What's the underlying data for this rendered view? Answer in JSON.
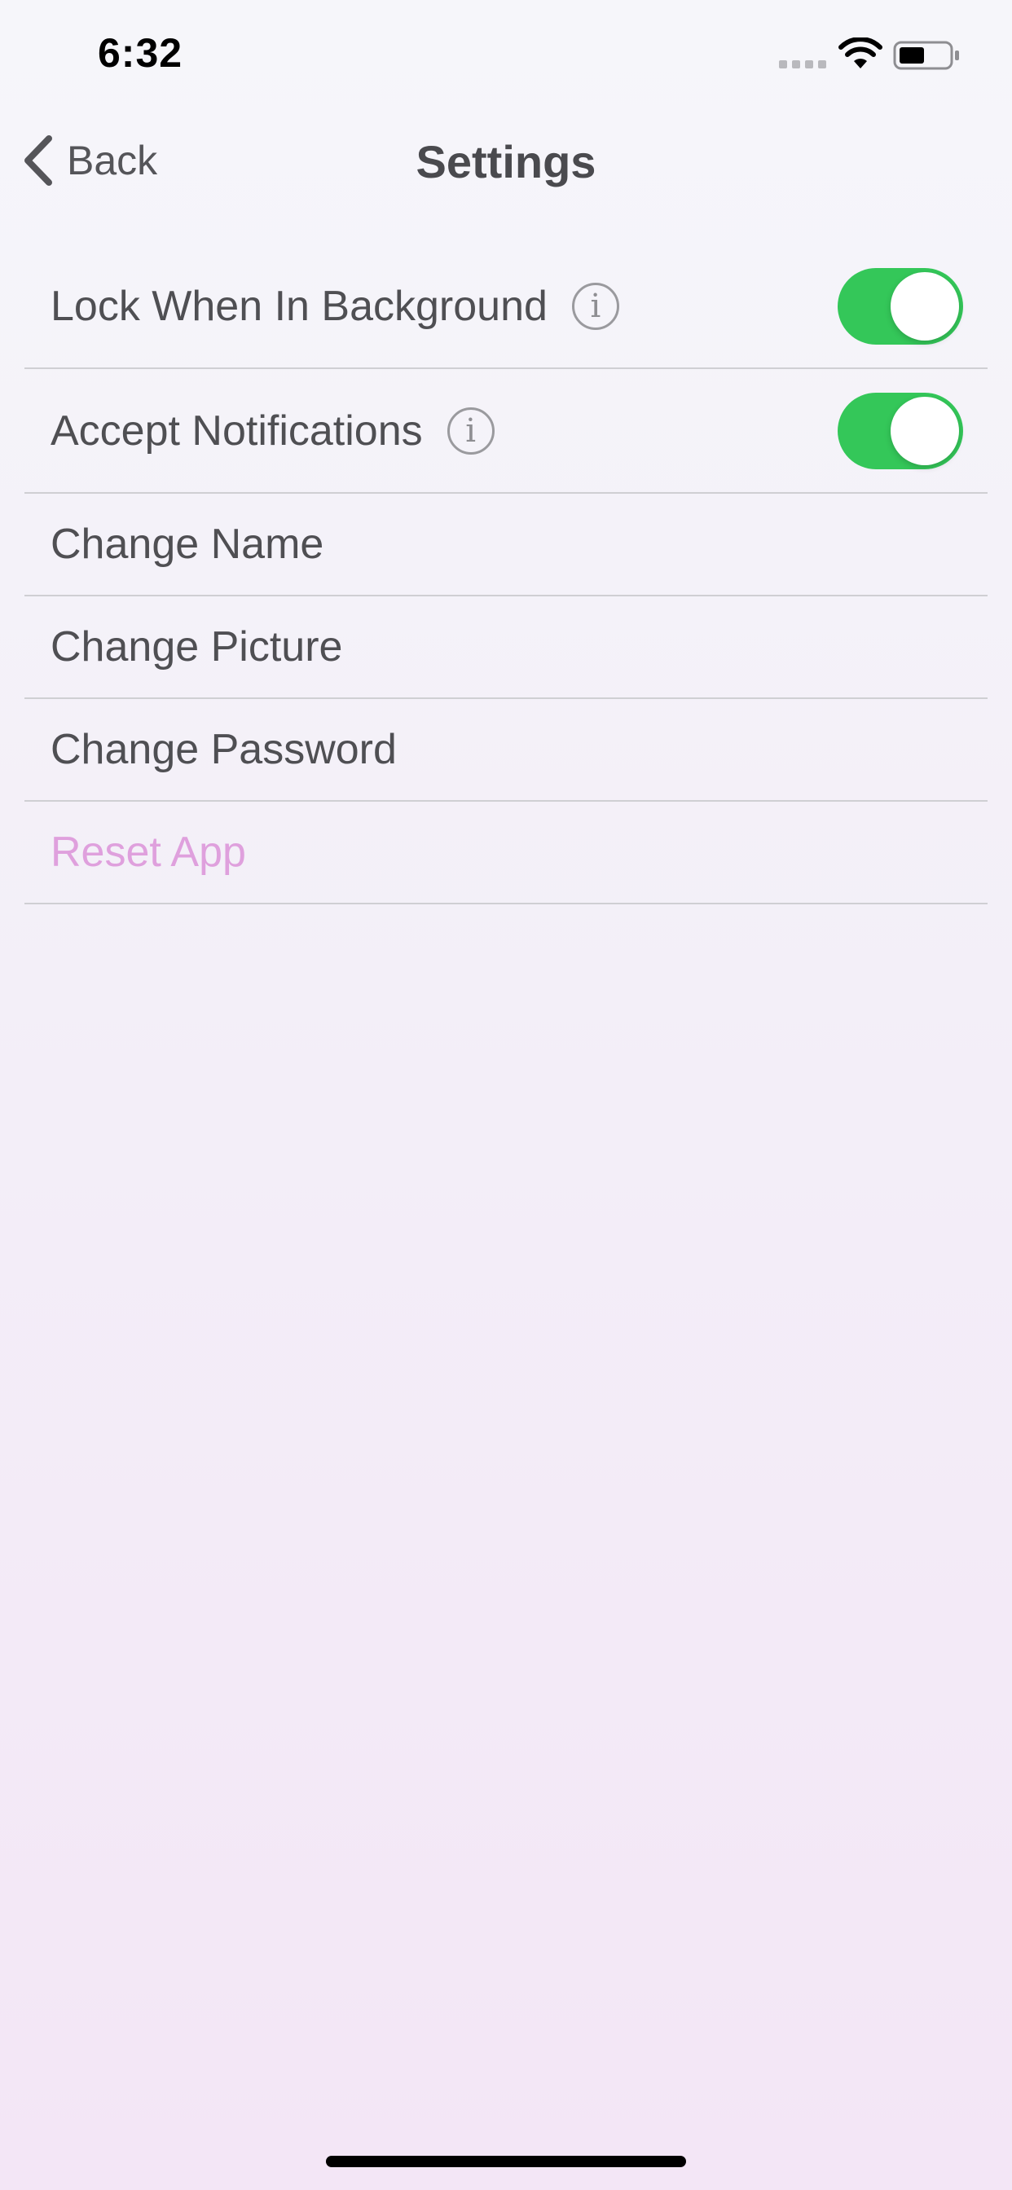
{
  "status_bar": {
    "time": "6:32",
    "icons": [
      "signal-dots-icon",
      "wifi-icon",
      "battery-icon"
    ]
  },
  "nav": {
    "back_label": "Back",
    "title": "Settings"
  },
  "settings": {
    "lock_in_background": {
      "label": "Lock When In Background",
      "info": "i",
      "enabled": true
    },
    "accept_notifications": {
      "label": "Accept Notifications",
      "info": "i",
      "enabled": true
    },
    "change_name": {
      "label": "Change Name"
    },
    "change_picture": {
      "label": "Change Picture"
    },
    "change_password": {
      "label": "Change Password"
    },
    "reset_app": {
      "label": "Reset App"
    }
  },
  "colors": {
    "toggle_on": "#34c759",
    "destructive_text": "#dfa0dd",
    "label_text": "#4f4f53",
    "background_top": "#f6f6fa",
    "background_bottom": "#f3e6f6"
  }
}
